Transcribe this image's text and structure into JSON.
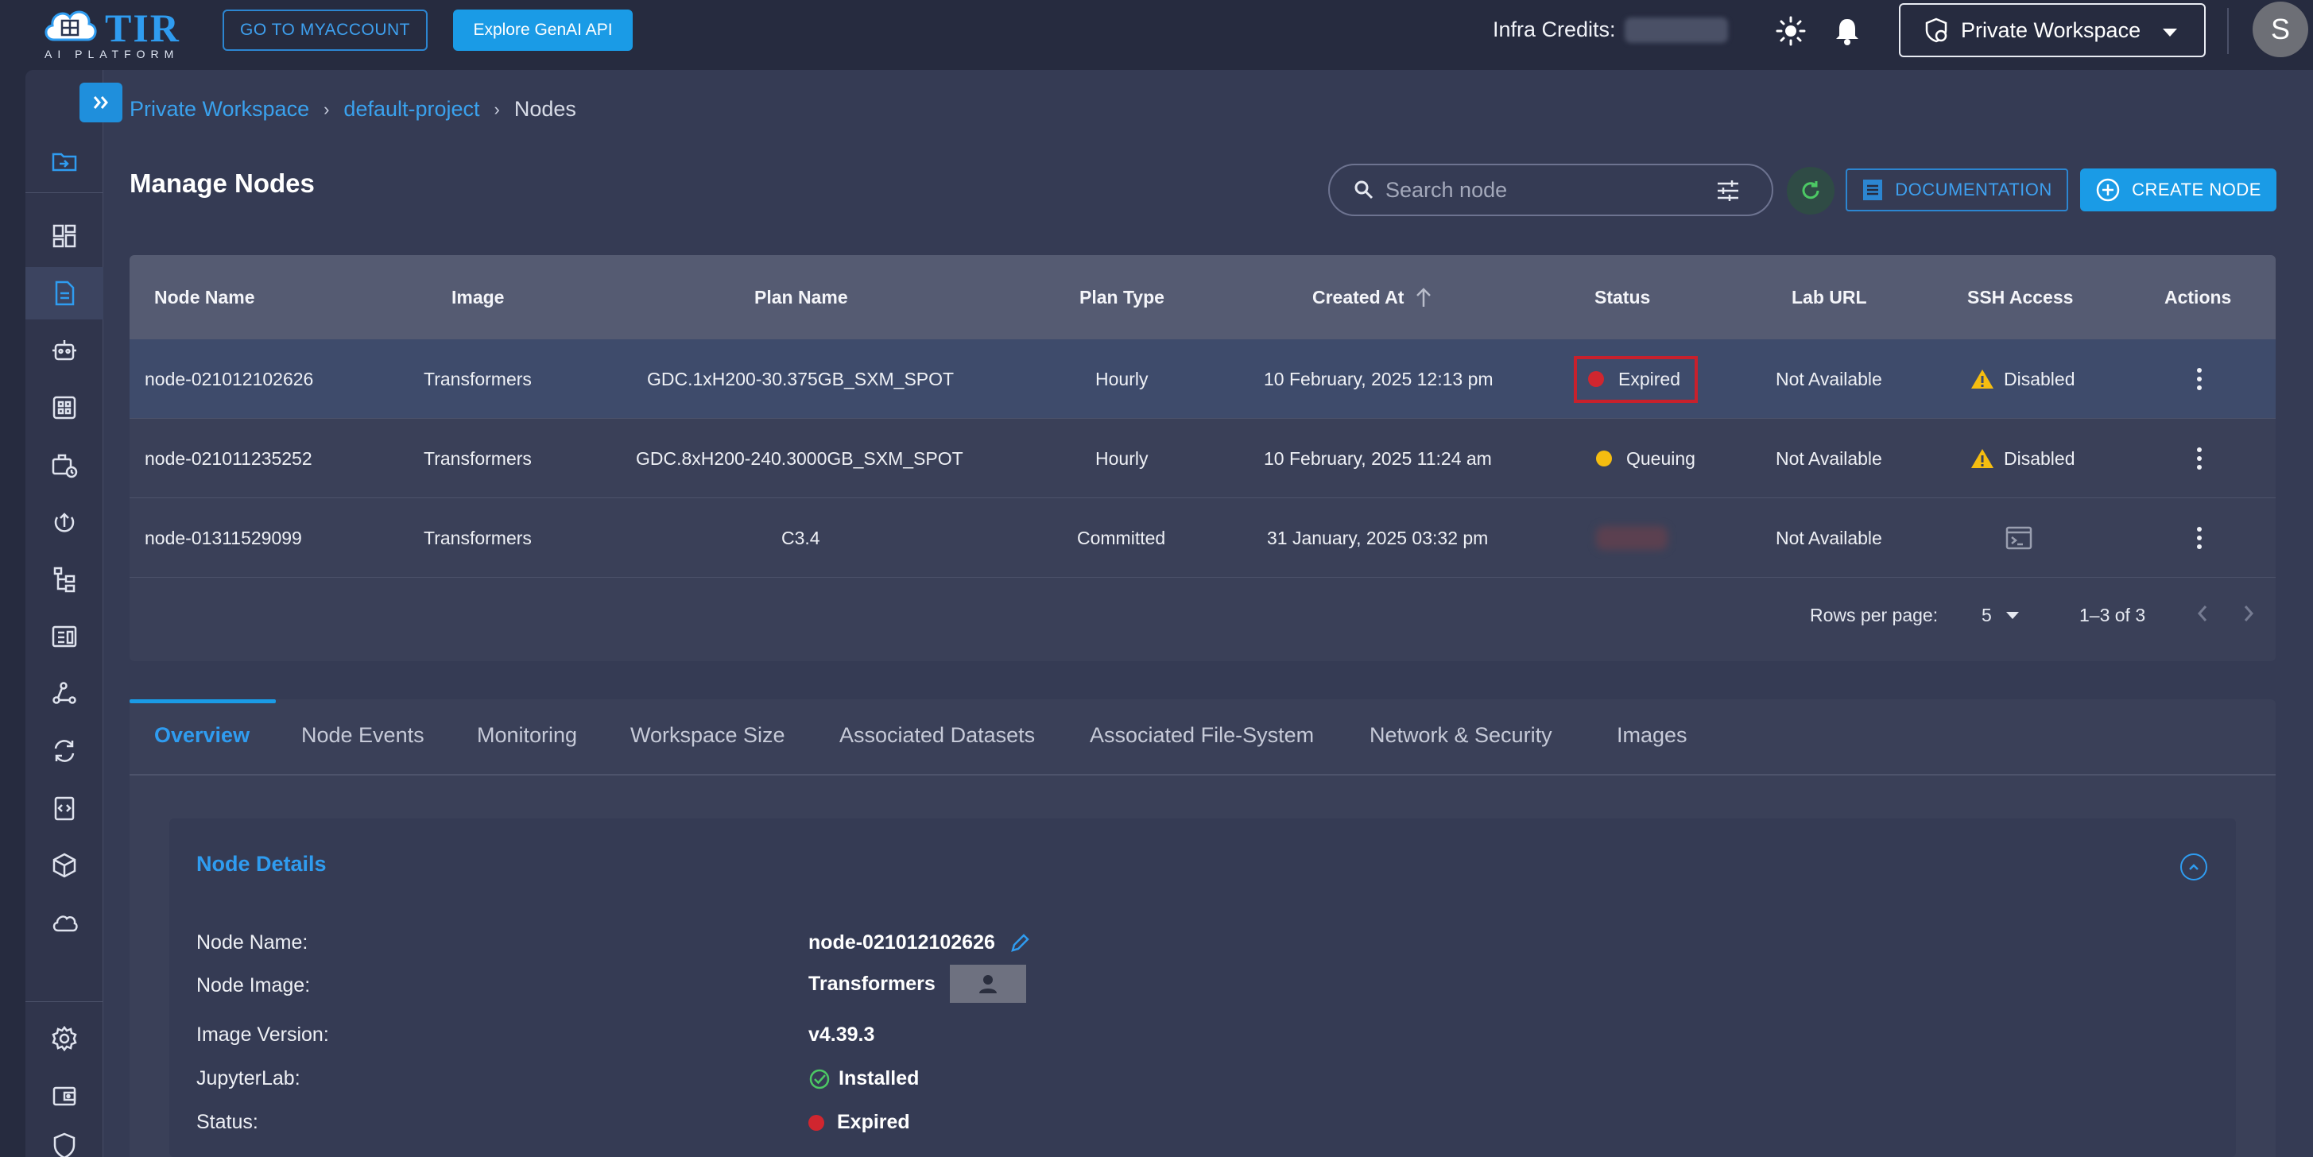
{
  "topbar": {
    "logo_text": "TIR",
    "logo_sub": "AI PLATFORM",
    "myaccount_label": "GO TO MYACCOUNT",
    "genai_label": "Explore GenAI API",
    "credits_label": "Infra Credits:",
    "workspace_label": "Private Workspace",
    "avatar_initial": "S"
  },
  "breadcrumb": {
    "items": [
      "Private Workspace",
      "default-project",
      "Nodes"
    ],
    "separator": "›"
  },
  "page": {
    "title": "Manage Nodes",
    "search_placeholder": "Search node",
    "documentation_label": "DOCUMENTATION",
    "create_label": "CREATE NODE"
  },
  "table": {
    "headers": [
      "Node Name",
      "Image",
      "Plan Name",
      "Plan Type",
      "Created At",
      "Status",
      "Lab URL",
      "SSH Access",
      "Actions"
    ],
    "sort_icon": "arrow-up-icon",
    "rows": [
      {
        "name": "node-021012102626",
        "image": "Transformers",
        "plan": "GDC.1xH200-30.375GB_SXM_SPOT",
        "plan_type": "Hourly",
        "created": "10 February, 2025 12:13 pm",
        "status": "Expired",
        "status_color": "#d0262f",
        "lab_url": "Not Available",
        "ssh": "Disabled",
        "selected": true
      },
      {
        "name": "node-021011235252",
        "image": "Transformers",
        "plan": "GDC.8xH200-240.3000GB_SXM_SPOT",
        "plan_type": "Hourly",
        "created": "10 February, 2025 11:24 am",
        "status": "Queuing",
        "status_color": "#f5bd10",
        "lab_url": "Not Available",
        "ssh": "Disabled",
        "selected": false
      },
      {
        "name": "node-01311529099",
        "image": "Transformers",
        "plan": "C3.4",
        "plan_type": "Committed",
        "created": "31 January, 2025 03:32 pm",
        "status": "",
        "status_color": "#d0262f",
        "lab_url": "Not Available",
        "ssh": "",
        "selected": false
      }
    ],
    "rows_per_page_label": "Rows per page:",
    "rows_per_page": "5",
    "range": "1–3 of 3"
  },
  "tabs": {
    "items": [
      "Overview",
      "Node Events",
      "Monitoring",
      "Workspace Size",
      "Associated Datasets",
      "Associated File-System",
      "Network & Security",
      "Images"
    ],
    "active": "Overview"
  },
  "details": {
    "title": "Node Details",
    "fields": [
      {
        "label": "Node Name:",
        "value": "node-021012102626"
      },
      {
        "label": "Node Image:",
        "value": "Transformers"
      },
      {
        "label": "Image Version:",
        "value": "v4.39.3"
      },
      {
        "label": "JupyterLab:",
        "value": "Installed"
      },
      {
        "label": "Status:",
        "value": "Expired"
      }
    ]
  },
  "colors": {
    "accent": "#1a9be6",
    "link": "#3aa2ee",
    "expired": "#d0262f",
    "queuing": "#f5bd10",
    "warning": "#f5bd10",
    "installed": "#4cc864",
    "background": "#262b3f",
    "panel": "#353b54"
  }
}
